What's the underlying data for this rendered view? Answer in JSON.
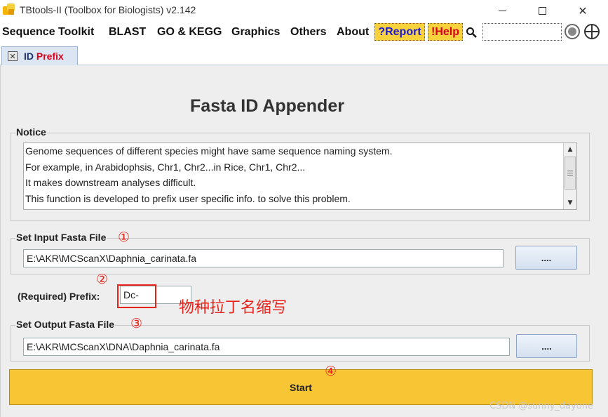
{
  "window": {
    "title": "TBtools-II (Toolbox for Biologists) v2.142",
    "minimize_label": "—",
    "maximize_label": "☐",
    "close_label": "✕"
  },
  "menu": {
    "items": [
      "Sequence Toolkit",
      "BLAST",
      "GO & KEGG",
      "Graphics",
      "Others",
      "About"
    ],
    "report_label": "?Report",
    "help_label": "!Help",
    "search_value": ""
  },
  "tab": {
    "label_id": "ID",
    "label_prefix": "Prefix"
  },
  "page": {
    "title": "Fasta ID Appender"
  },
  "notice": {
    "title": "Notice",
    "lines": [
      "Genome sequences of different species might have same sequence naming system.",
      "For example, in Arabidophsis, Chr1, Chr2...in Rice, Chr1, Chr2...",
      "It makes downstream analyses difficult.",
      "This function is developed to prefix user specific info. to solve this problem."
    ]
  },
  "input_file": {
    "title": "Set Input Fasta File",
    "value": "E:\\AKR\\MCScanX\\Daphnia_carinata.fa",
    "browse_label": "...."
  },
  "prefix": {
    "label": "(Required) Prefix:",
    "value": "Dc-"
  },
  "output_file": {
    "title": "Set Output Fasta File",
    "value": "E:\\AKR\\MCScanX\\DNA\\Daphnia_carinata.fa",
    "browse_label": "...."
  },
  "start_button": {
    "label": "Start"
  },
  "annotations": {
    "marker_1": "①",
    "marker_2": "②",
    "marker_3": "③",
    "marker_4": "④",
    "note": "物种拉丁名缩写"
  },
  "watermark": "CSDN @sunny_dayone",
  "colors": {
    "accent_yellow": "#f8c534",
    "report_text": "#1a1ad6",
    "help_text": "#d9001b",
    "annotation_red": "#e8231b"
  }
}
